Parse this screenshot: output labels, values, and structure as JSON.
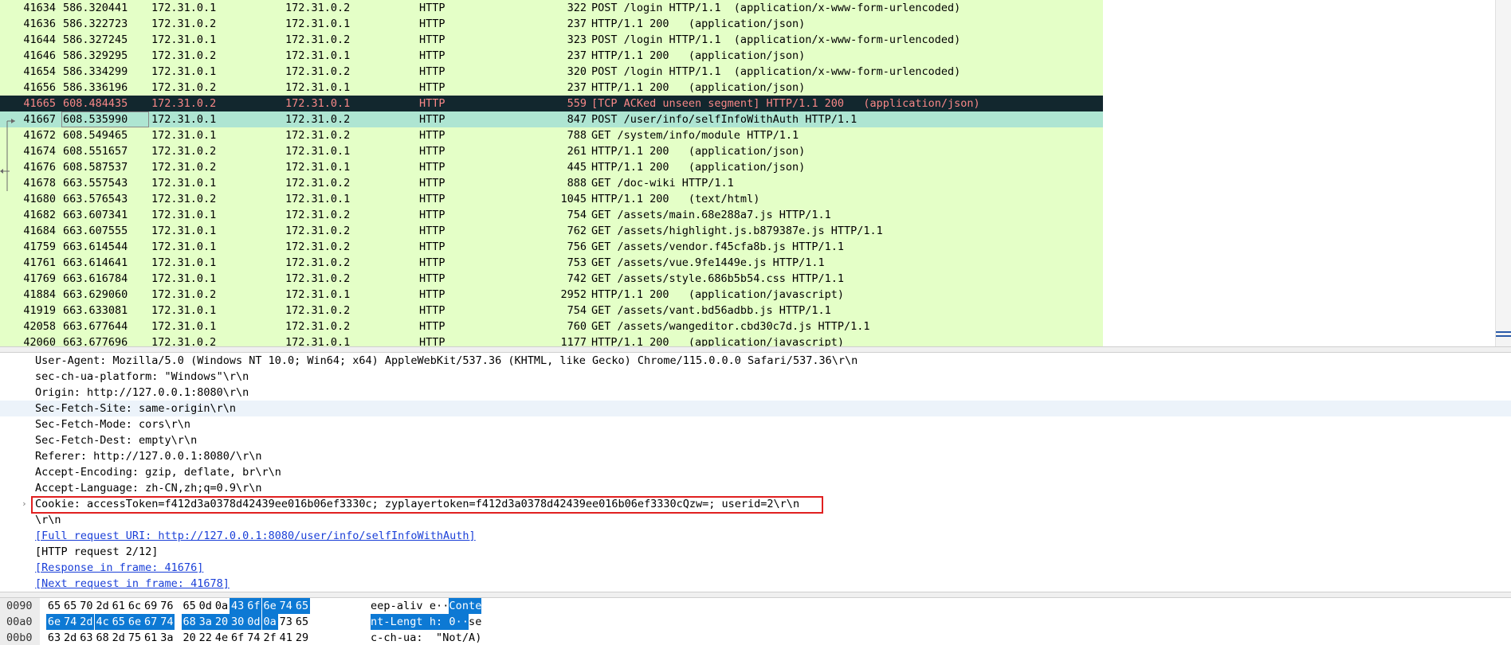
{
  "packets": [
    {
      "no": "41634",
      "time": "586.320441",
      "src": "172.31.0.1",
      "dst": "172.31.0.2",
      "proto": "HTTP",
      "len": "322",
      "info": "POST /login HTTP/1.1  (application/x-www-form-urlencoded)",
      "state": ""
    },
    {
      "no": "41636",
      "time": "586.322723",
      "src": "172.31.0.2",
      "dst": "172.31.0.1",
      "proto": "HTTP",
      "len": "237",
      "info": "HTTP/1.1 200   (application/json)",
      "state": ""
    },
    {
      "no": "41644",
      "time": "586.327245",
      "src": "172.31.0.1",
      "dst": "172.31.0.2",
      "proto": "HTTP",
      "len": "323",
      "info": "POST /login HTTP/1.1  (application/x-www-form-urlencoded)",
      "state": ""
    },
    {
      "no": "41646",
      "time": "586.329295",
      "src": "172.31.0.2",
      "dst": "172.31.0.1",
      "proto": "HTTP",
      "len": "237",
      "info": "HTTP/1.1 200   (application/json)",
      "state": ""
    },
    {
      "no": "41654",
      "time": "586.334299",
      "src": "172.31.0.1",
      "dst": "172.31.0.2",
      "proto": "HTTP",
      "len": "320",
      "info": "POST /login HTTP/1.1  (application/x-www-form-urlencoded)",
      "state": ""
    },
    {
      "no": "41656",
      "time": "586.336196",
      "src": "172.31.0.2",
      "dst": "172.31.0.1",
      "proto": "HTTP",
      "len": "237",
      "info": "HTTP/1.1 200   (application/json)",
      "state": ""
    },
    {
      "no": "41665",
      "time": "608.484435",
      "src": "172.31.0.2",
      "dst": "172.31.0.1",
      "proto": "HTTP",
      "len": "559",
      "info": "[TCP ACKed unseen segment] HTTP/1.1 200   (application/json)",
      "state": "selected"
    },
    {
      "no": "41667",
      "time": "608.535990",
      "src": "172.31.0.1",
      "dst": "172.31.0.2",
      "proto": "HTTP",
      "len": "847",
      "info": "POST /user/info/selfInfoWithAuth HTTP/1.1",
      "state": "related"
    },
    {
      "no": "41672",
      "time": "608.549465",
      "src": "172.31.0.1",
      "dst": "172.31.0.2",
      "proto": "HTTP",
      "len": "788",
      "info": "GET /system/info/module HTTP/1.1",
      "state": ""
    },
    {
      "no": "41674",
      "time": "608.551657",
      "src": "172.31.0.2",
      "dst": "172.31.0.1",
      "proto": "HTTP",
      "len": "261",
      "info": "HTTP/1.1 200   (application/json)",
      "state": ""
    },
    {
      "no": "41676",
      "time": "608.587537",
      "src": "172.31.0.2",
      "dst": "172.31.0.1",
      "proto": "HTTP",
      "len": "445",
      "info": "HTTP/1.1 200   (application/json)",
      "state": ""
    },
    {
      "no": "41678",
      "time": "663.557543",
      "src": "172.31.0.1",
      "dst": "172.31.0.2",
      "proto": "HTTP",
      "len": "888",
      "info": "GET /doc-wiki HTTP/1.1",
      "state": ""
    },
    {
      "no": "41680",
      "time": "663.576543",
      "src": "172.31.0.2",
      "dst": "172.31.0.1",
      "proto": "HTTP",
      "len": "1045",
      "info": "HTTP/1.1 200   (text/html)",
      "state": ""
    },
    {
      "no": "41682",
      "time": "663.607341",
      "src": "172.31.0.1",
      "dst": "172.31.0.2",
      "proto": "HTTP",
      "len": "754",
      "info": "GET /assets/main.68e288a7.js HTTP/1.1",
      "state": ""
    },
    {
      "no": "41684",
      "time": "663.607555",
      "src": "172.31.0.1",
      "dst": "172.31.0.2",
      "proto": "HTTP",
      "len": "762",
      "info": "GET /assets/highlight.js.b879387e.js HTTP/1.1",
      "state": ""
    },
    {
      "no": "41759",
      "time": "663.614544",
      "src": "172.31.0.1",
      "dst": "172.31.0.2",
      "proto": "HTTP",
      "len": "756",
      "info": "GET /assets/vendor.f45cfa8b.js HTTP/1.1",
      "state": ""
    },
    {
      "no": "41761",
      "time": "663.614641",
      "src": "172.31.0.1",
      "dst": "172.31.0.2",
      "proto": "HTTP",
      "len": "753",
      "info": "GET /assets/vue.9fe1449e.js HTTP/1.1",
      "state": ""
    },
    {
      "no": "41769",
      "time": "663.616784",
      "src": "172.31.0.1",
      "dst": "172.31.0.2",
      "proto": "HTTP",
      "len": "742",
      "info": "GET /assets/style.686b5b54.css HTTP/1.1",
      "state": ""
    },
    {
      "no": "41884",
      "time": "663.629060",
      "src": "172.31.0.2",
      "dst": "172.31.0.1",
      "proto": "HTTP",
      "len": "2952",
      "info": "HTTP/1.1 200   (application/javascript)",
      "state": ""
    },
    {
      "no": "41919",
      "time": "663.633081",
      "src": "172.31.0.1",
      "dst": "172.31.0.2",
      "proto": "HTTP",
      "len": "754",
      "info": "GET /assets/vant.bd56adbb.js HTTP/1.1",
      "state": ""
    },
    {
      "no": "42058",
      "time": "663.677644",
      "src": "172.31.0.1",
      "dst": "172.31.0.2",
      "proto": "HTTP",
      "len": "760",
      "info": "GET /assets/wangeditor.cbd30c7d.js HTTP/1.1",
      "state": ""
    },
    {
      "no": "42060",
      "time": "663.677696",
      "src": "172.31.0.2",
      "dst": "172.31.0.1",
      "proto": "HTTP",
      "len": "1177",
      "info": "HTTP/1.1 200   (application/javascript)",
      "state": ""
    }
  ],
  "details": [
    {
      "text": "User-Agent: Mozilla/5.0 (Windows NT 10.0; Win64; x64) AppleWebKit/537.36 (KHTML, like Gecko) Chrome/115.0.0.0 Safari/537.36\\r\\n",
      "kind": "plain"
    },
    {
      "text": "sec-ch-ua-platform: \"Windows\"\\r\\n",
      "kind": "plain"
    },
    {
      "text": "Origin: http://127.0.0.1:8080\\r\\n",
      "kind": "plain"
    },
    {
      "text": "Sec-Fetch-Site: same-origin\\r\\n",
      "kind": "hl"
    },
    {
      "text": "Sec-Fetch-Mode: cors\\r\\n",
      "kind": "plain"
    },
    {
      "text": "Sec-Fetch-Dest: empty\\r\\n",
      "kind": "plain"
    },
    {
      "text": "Referer: http://127.0.0.1:8080/\\r\\n",
      "kind": "plain"
    },
    {
      "text": "Accept-Encoding: gzip, deflate, br\\r\\n",
      "kind": "plain"
    },
    {
      "text": "Accept-Language: zh-CN,zh;q=0.9\\r\\n",
      "kind": "plain"
    },
    {
      "text": "Cookie: accessToken=f412d3a0378d42439ee016b06ef3330c; zyplayertoken=f412d3a0378d42439ee016b06ef3330cQzw=; userid=2\\r\\n",
      "kind": "expandable"
    },
    {
      "text": "\\r\\n",
      "kind": "plain"
    },
    {
      "text": "[Full request URI: http://127.0.0.1:8080/user/info/selfInfoWithAuth]",
      "kind": "link"
    },
    {
      "text": "[HTTP request 2/12]",
      "kind": "plain"
    },
    {
      "text": "[Response in frame: 41676]",
      "kind": "link"
    },
    {
      "text": "[Next request in frame: 41678]",
      "kind": "link"
    }
  ],
  "expander_glyph": "›",
  "bytes": [
    {
      "offset": "0090",
      "hex": [
        "65",
        "65",
        "70",
        "2d",
        "61",
        "6c",
        "69",
        "76",
        "65",
        "0d",
        "0a",
        "43",
        "6f",
        "6e",
        "74",
        "65"
      ],
      "ascii": [
        "e",
        "e",
        "p",
        "-",
        "a",
        "l",
        "i",
        "v",
        " ",
        "e",
        "·",
        "·",
        "C",
        "o",
        "n",
        "t",
        "e"
      ],
      "hex_sel_from": 11,
      "ascii_text": "eep-aliv e··Conte",
      "ascii_sel_from": 12
    },
    {
      "offset": "00a0",
      "hex": [
        "6e",
        "74",
        "2d",
        "4c",
        "65",
        "6e",
        "67",
        "74",
        "68",
        "3a",
        "20",
        "30",
        "0d",
        "0a",
        "73",
        "65"
      ],
      "ascii_text": "nt-Lengt h: 0··se",
      "hex_sel_to": 13,
      "ascii_sel_to": 14
    },
    {
      "offset": "00b0",
      "hex": [
        "63",
        "2d",
        "63",
        "68",
        "2d",
        "75",
        "61",
        "3a",
        "20",
        "22",
        "4e",
        "6f",
        "74",
        "2f",
        "41",
        "29"
      ],
      "ascii_text": "c-ch-ua:  \"Not/A)"
    }
  ]
}
